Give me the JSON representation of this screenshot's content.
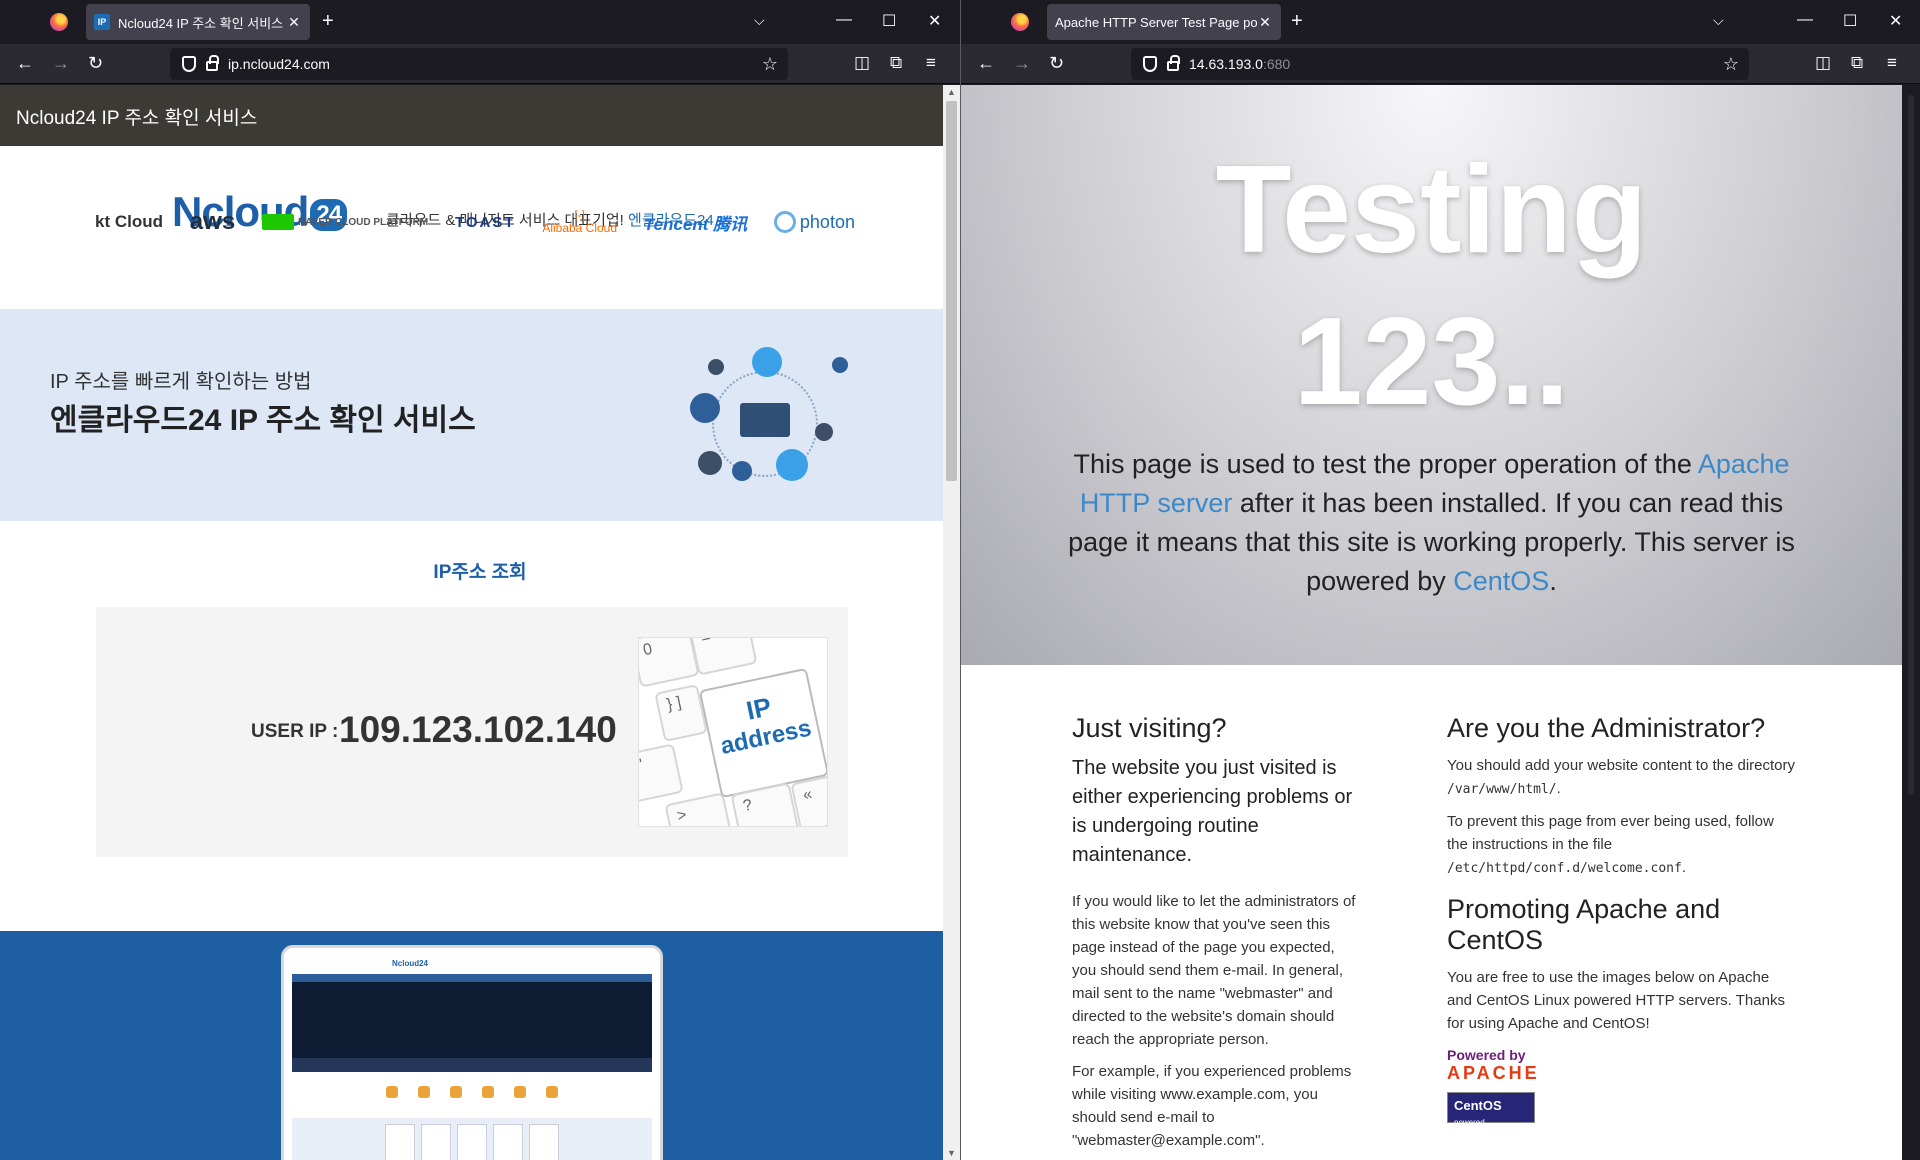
{
  "left": {
    "tab_title": "Ncloud24 IP 주소 확인 서비스",
    "url": "ip.ncloud24.com",
    "header": "Ncloud24 IP 주소 확인 서비스",
    "logo": {
      "n": "N",
      "cloud": "cloud",
      "num": "24"
    },
    "slogan": "클라우드 & 매니지드 서비스 대표기업!",
    "slogan_brand": "엔클라우드24",
    "partners": {
      "kt": "kt Cloud",
      "aws": "aws",
      "naver": "NAVER CLOUD PLATFORM",
      "toast": "TOAST",
      "alibaba": "Alibaba Cloud",
      "tencent": "Tencent 腾讯",
      "photon": "photon"
    },
    "hero_sub": "IP 주소를 빠르게 확인하는 방법",
    "hero_main": "엔클라우드24 IP 주소 확인 서비스",
    "search_title": "IP주소 조회",
    "user_ip_label": "USER IP :",
    "user_ip": "109.123.102.140",
    "key_label_1": "IP",
    "key_label_2": "address",
    "laptop_logo": "Ncloud24"
  },
  "right": {
    "tab_title": "Apache HTTP Server Test Page po",
    "url_host": "14.63.193.0",
    "url_port": ":680",
    "hero_line1": "Testing",
    "hero_line2": "123..",
    "intro_1": "This page is used to test the proper operation of the",
    "intro_link1": "Apache HTTP server",
    "intro_2": "after it has been installed. If you can read this page it means that this site is working properly. This server is powered by",
    "intro_link2": "CentOS",
    "intro_end": ".",
    "visiting": {
      "heading": "Just visiting?",
      "lead": "The website you just visited is either experiencing problems or is undergoing routine maintenance.",
      "p1": "If you would like to let the administrators of this website know that you've seen this page instead of the page you expected, you should send them e-mail. In general, mail sent to the name \"webmaster\" and directed to the website's domain should reach the appropriate person.",
      "p2": "For example, if you experienced problems while visiting www.example.com, you should send e-mail to \"webmaster@example.com\"."
    },
    "admin": {
      "heading": "Are you the Administrator?",
      "p1_a": "You should add your website content to the directory",
      "p1_code": "/var/www/html/",
      "p1_b": ".",
      "p2_a": "To prevent this page from ever being used, follow the instructions in the file",
      "p2_code": "/etc/httpd/conf.d/welcome.conf",
      "p2_b": ".",
      "promo_heading": "Promoting Apache and CentOS",
      "promo_p": "You are free to use the images below on Apache and CentOS Linux powered HTTP servers. Thanks for using Apache and CentOS!",
      "badge_powered": "Powered by",
      "badge_apache": "APACHE",
      "badge_centos": "CentOS",
      "badge_centos_sub": "powered"
    }
  }
}
